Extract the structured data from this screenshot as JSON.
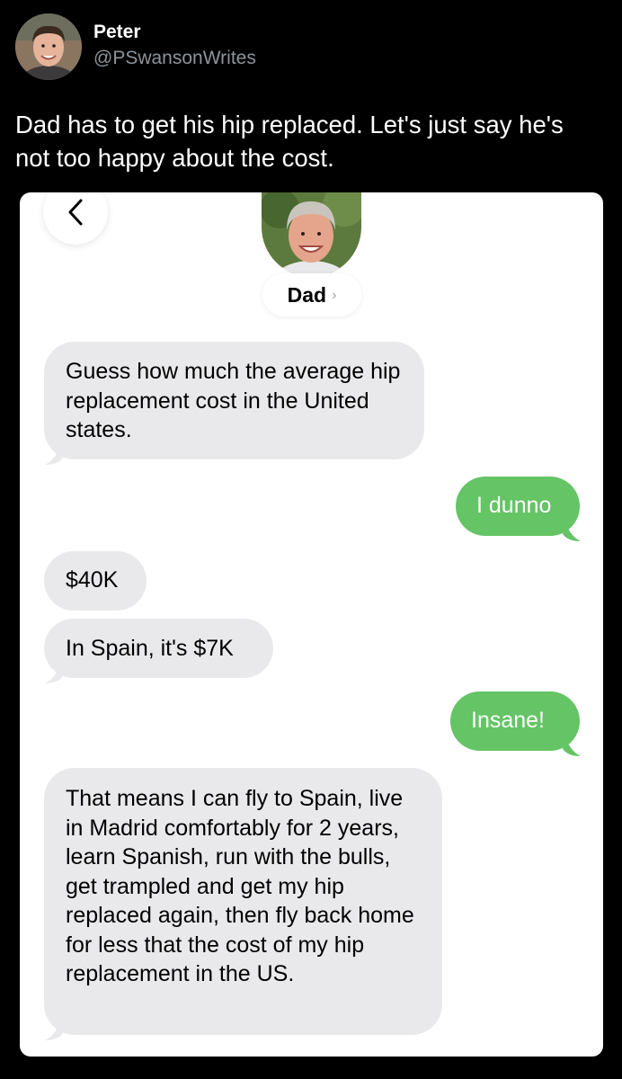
{
  "tweet": {
    "author_name": "Peter",
    "author_handle": "@PSwansonWrites",
    "text": "Dad has to get his hip replaced. Let's just say he's not too happy about the cost."
  },
  "conversation": {
    "contact_name": "Dad",
    "contact_chevron": "›",
    "messages": [
      {
        "direction": "incoming",
        "text": "Guess how much the average hip replacement cost in the United states."
      },
      {
        "direction": "outgoing",
        "text": "I dunno"
      },
      {
        "direction": "incoming",
        "text": "$40K"
      },
      {
        "direction": "incoming",
        "text": "In Spain, it's $7K"
      },
      {
        "direction": "outgoing",
        "text": "Insane!"
      },
      {
        "direction": "incoming",
        "text": "That means I can fly to Spain, live in Madrid comfortably for 2 years, learn Spanish, run with the bulls, get trampled and get my hip replaced again, then fly back home for less that the cost of my hip replacement in the US."
      }
    ]
  },
  "colors": {
    "background": "#000000",
    "incoming_bubble": "#e9e9eb",
    "outgoing_bubble": "#65c466",
    "handle_gray": "#8d9399"
  },
  "icons": {
    "back": "chevron-left-icon",
    "contact_disclosure": "chevron-right-icon"
  }
}
